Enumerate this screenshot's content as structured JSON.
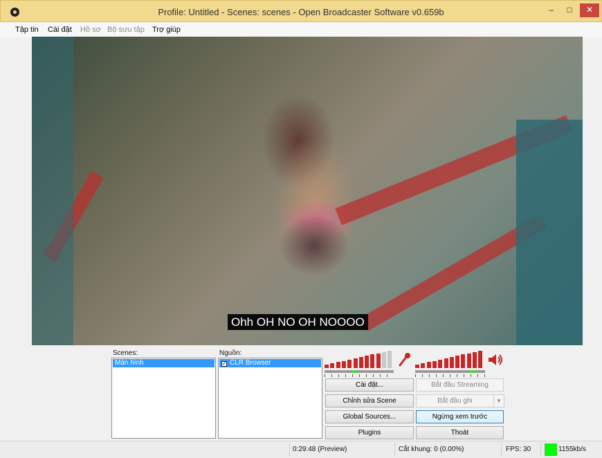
{
  "window": {
    "title": "Profile: Untitled - Scenes: scenes - Open Broadcaster Software v0.659b",
    "minimize_glyph": "–",
    "maximize_glyph": "□",
    "close_glyph": "✕"
  },
  "menu": [
    "Tập tin",
    "Cài đặt",
    "Hồ sơ",
    "Bộ sưu tập",
    "Trợ giúp"
  ],
  "preview": {
    "subtitle": "Ohh OH NO OH NOOOO"
  },
  "scenes": {
    "label": "Scenes:",
    "items": [
      "Màn hình"
    ]
  },
  "sources": {
    "label": "Nguồn:",
    "items": [
      "CLR Browser"
    ]
  },
  "buttons": {
    "settings": "Cài đặt...",
    "start_streaming": "Bắt đầu Streaming",
    "edit_scene": "Chỉnh sửa Scene",
    "start_recording": "Bắt đầu ghi",
    "global_sources": "Global Sources...",
    "stop_preview": "Ngừng xem trước",
    "plugins": "Plugins",
    "exit": "Thoát"
  },
  "status": {
    "time": "0:29:48 (Preview)",
    "dropped_frames": "Cắt khung: 0 (0.00%)",
    "fps": "FPS: 30",
    "bitrate": "1155kb/s",
    "bitrate_color": "#00ff00"
  },
  "colors": {
    "titlebar": "#f1d98d",
    "meter": "#c62828",
    "selection": "#3399ff"
  },
  "meters": {
    "mic_level": 0.85,
    "desktop_level": 1.0
  }
}
